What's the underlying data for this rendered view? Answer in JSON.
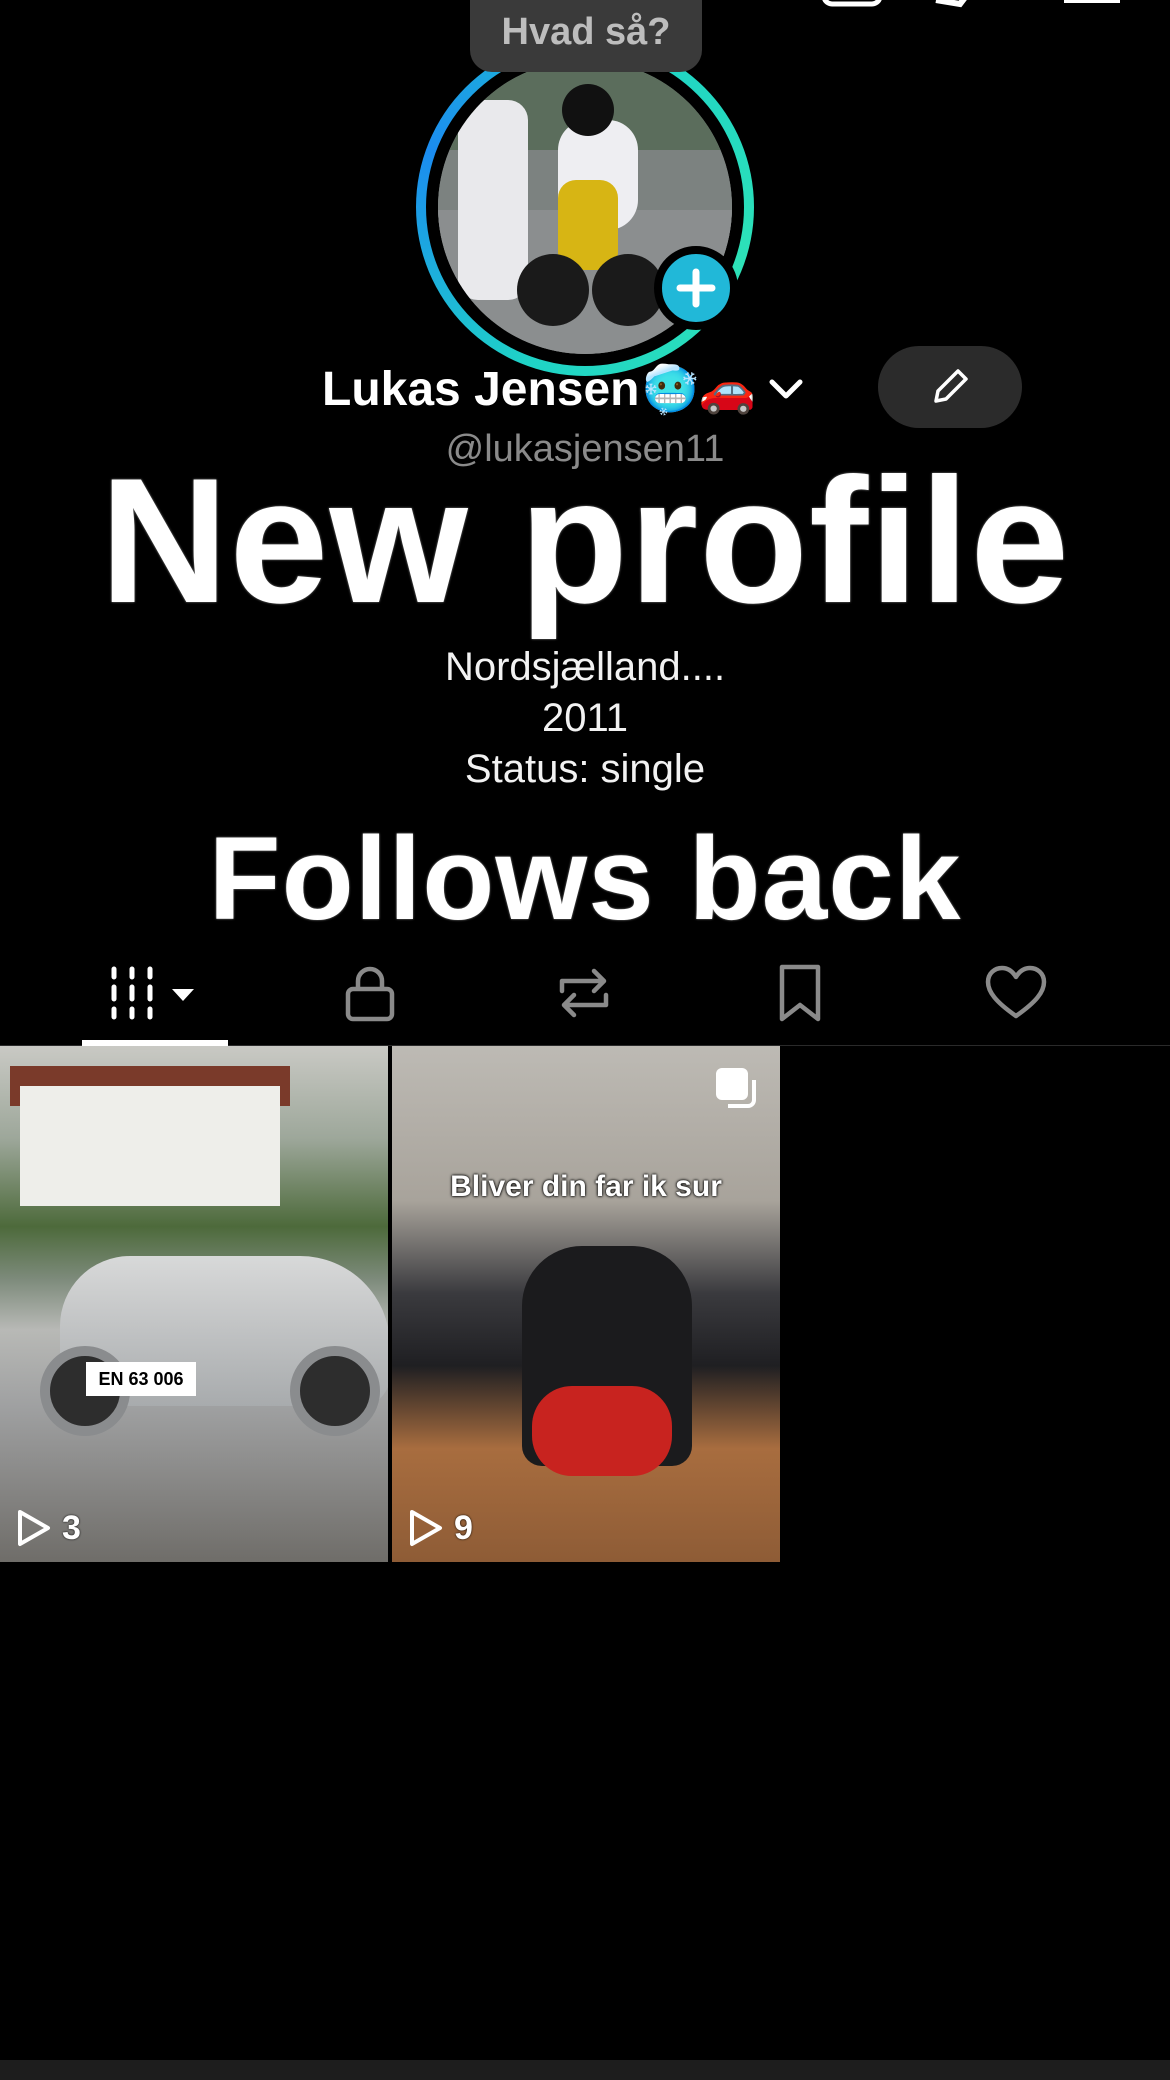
{
  "note": {
    "text": "Hvad så?"
  },
  "profile": {
    "name": "Lukas Jensen",
    "name_emojis": "🥶🚗",
    "handle": "@lukasjensen11",
    "bio": [
      "Nordsjælland....",
      "2011",
      "Status: single"
    ]
  },
  "overlay": {
    "line1": "New profile",
    "line2": "Follows back"
  },
  "tabs": [
    {
      "name": "videos",
      "icon": "grid-icon",
      "selected": true
    },
    {
      "name": "private",
      "icon": "lock-icon",
      "selected": false
    },
    {
      "name": "reposts",
      "icon": "repost-icon",
      "selected": false
    },
    {
      "name": "favorites",
      "icon": "bookmark-icon",
      "selected": false
    },
    {
      "name": "liked",
      "icon": "heart-icon",
      "selected": false
    }
  ],
  "videos": [
    {
      "plate": "EN 63 006",
      "views": "3"
    },
    {
      "caption": "Bliver din far ik sur",
      "views": "9"
    }
  ],
  "colors": {
    "ring_start": "#1fd3c6",
    "ring_end": "#1b8cf0",
    "add_button": "#21b8d8",
    "background": "#000000"
  }
}
